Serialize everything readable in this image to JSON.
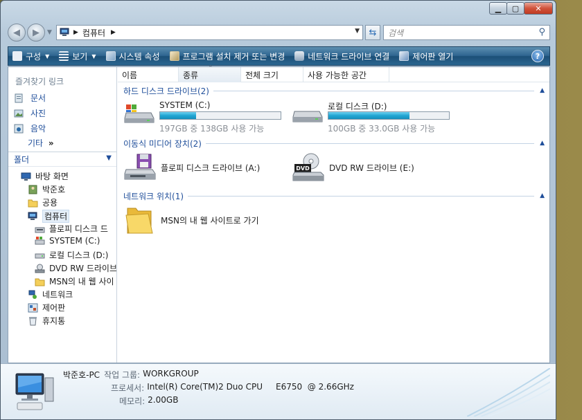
{
  "address": {
    "crumb": "컴퓨터"
  },
  "search": {
    "placeholder": "검색"
  },
  "toolbar": {
    "items": [
      {
        "label": "구성",
        "dropdown": true
      },
      {
        "label": "보기",
        "dropdown": true
      },
      {
        "label": "시스템 속성"
      },
      {
        "label": "프로그램 설치 제거 또는 변경"
      },
      {
        "label": "네트워크 드라이브 연결"
      },
      {
        "label": "제어판 열기"
      }
    ],
    "help": "?"
  },
  "favorites": {
    "title": "즐겨찾기 링크",
    "items": [
      "문서",
      "사진",
      "음악"
    ],
    "more": "기타",
    "more_arrow": "»"
  },
  "folders": {
    "title": "폴더",
    "tree": [
      "바탕 화면",
      "박준호",
      "공용",
      "컴퓨터",
      "플로피 디스크 드",
      "SYSTEM (C:)",
      "로컬 디스크 (D:)",
      "DVD RW 드라이브",
      "MSN의 내 웹 사이",
      "네트워크",
      "제어판",
      "휴지통"
    ]
  },
  "columns": [
    "이름",
    "종류",
    "전체 크기",
    "사용 가능한 공간"
  ],
  "groups": {
    "hdd": "하드 디스크 드라이브(2)",
    "removable": "이동식 미디어 장치(2)",
    "network": "네트워크 위치(1)"
  },
  "drives": [
    {
      "name": "SYSTEM (C:)",
      "info": "197GB 중 138GB 사용 가능",
      "used_fraction": 0.3
    },
    {
      "name": "로컬 디스크 (D:)",
      "info": "100GB 중 33.0GB 사용 가능",
      "used_fraction": 0.67
    }
  ],
  "devices": [
    {
      "name": "플로피 디스크 드라이브 (A:)"
    },
    {
      "name": "DVD RW 드라이브 (E:)",
      "badge": "DVD"
    }
  ],
  "network_items": [
    {
      "name": "MSN의 내 웹 사이트로 가기"
    }
  ],
  "details": {
    "pc_name": "박준호-PC",
    "workgroup_label": "작업 그룹:",
    "workgroup": "WORKGROUP",
    "cpu_label": "프로세서:",
    "cpu": "Intel(R) Core(TM)2 Duo CPU     E6750  @ 2.66GHz",
    "mem_label": "메모리:",
    "mem": "2.00GB"
  }
}
